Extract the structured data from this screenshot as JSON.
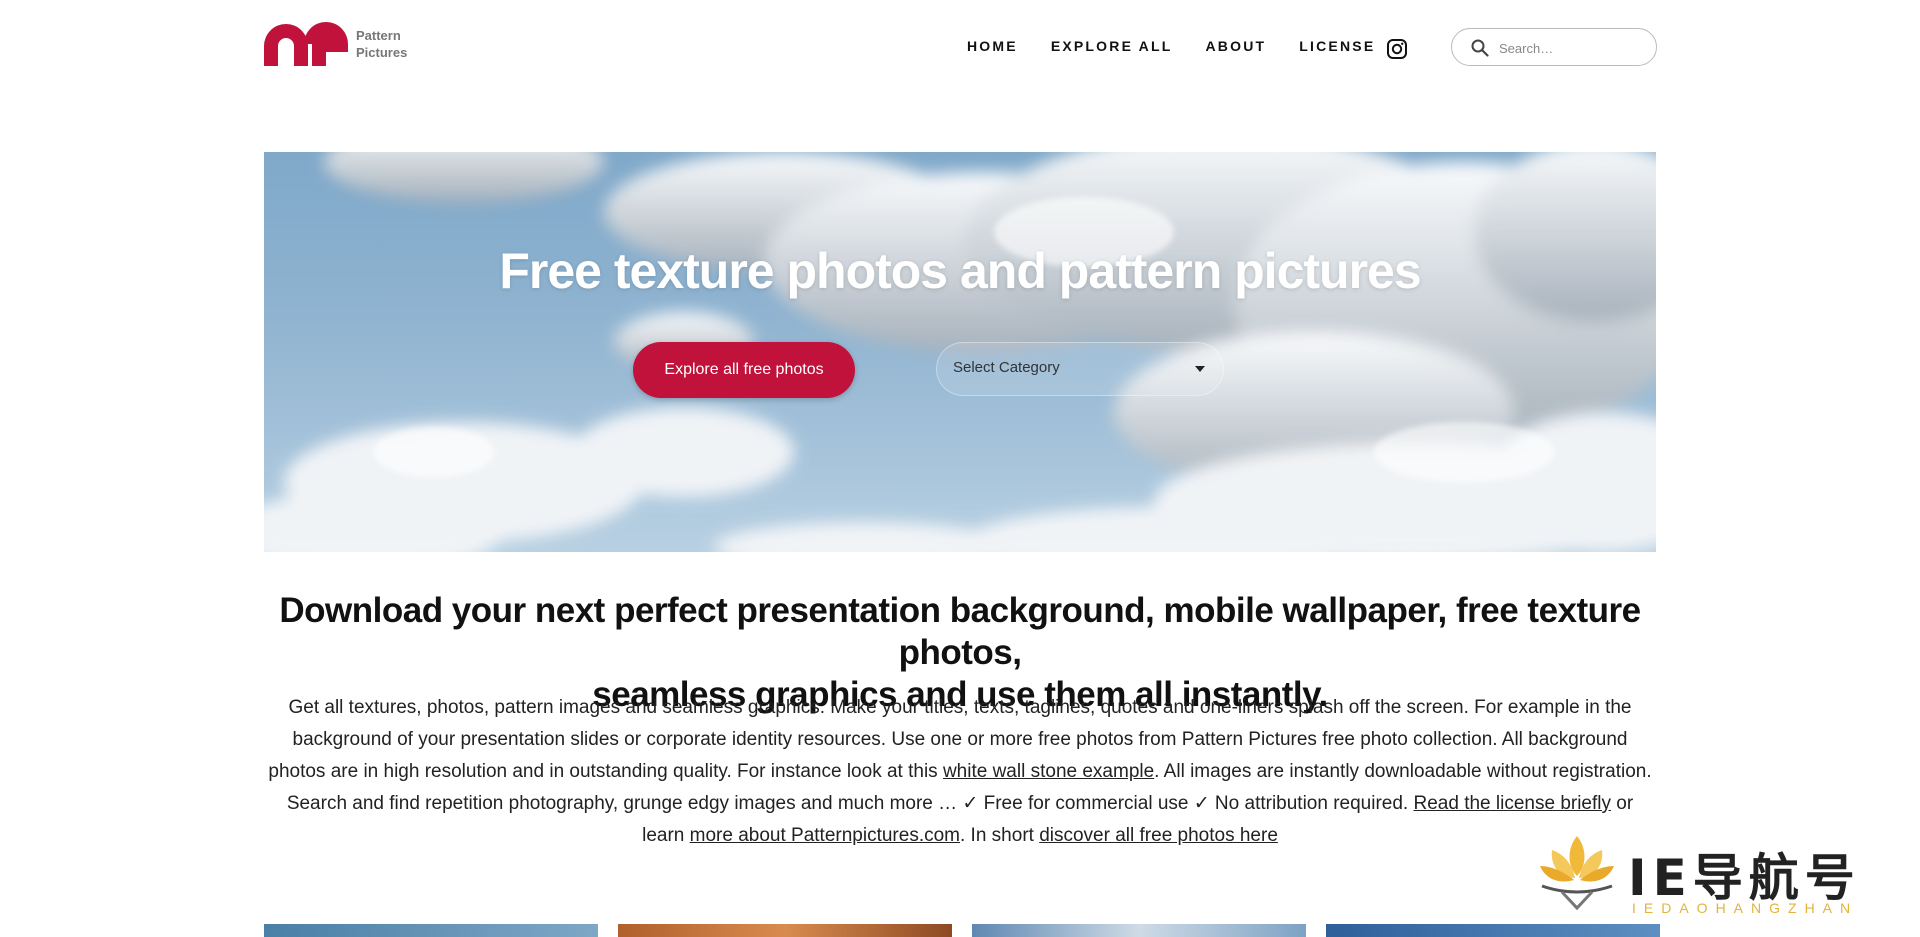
{
  "brand": {
    "name_line1": "Pattern",
    "name_line2": "Pictures",
    "color": "#c0123a"
  },
  "nav": {
    "items": [
      "HOME",
      "EXPLORE ALL",
      "ABOUT",
      "LICENSE"
    ]
  },
  "search": {
    "placeholder": "Search…"
  },
  "hero": {
    "title": "Free texture photos and pattern pictures",
    "button_label": "Explore all free photos",
    "select_label": "Select Category"
  },
  "headline": {
    "line1": "Download your next perfect presentation background, mobile wallpaper, free texture photos,",
    "line2": "seamless graphics and use them all instantly."
  },
  "description": {
    "p1": "Get all textures, photos, pattern images and seamless graphics. Make your titles, texts, taglines, quotes and one-liners splash off the screen. For example in the background of your presentation slides or corporate identity resources. Use one or more free photos from Pattern Pictures free photo collection. All background photos are in high resolution and in outstanding quality. For instance look at this ",
    "link1": "white wall stone example",
    "p2": ". All images are instantly downloadable without registration. Search and find repetition photography, grunge edgy images and much more … ✓ Free for commercial use ✓ No attribution required. ",
    "link2": "Read the license briefly",
    "p3": " or learn ",
    "link3": "more about Patternpictures.com",
    "p4": ". In short ",
    "link4": "discover all free photos here"
  },
  "watermark": {
    "cn": "IE导航号",
    "en": "IEDAOHANGZHAN"
  },
  "icons": {
    "social": "instagram-icon",
    "search": "search-icon",
    "select": "caret-down-icon"
  }
}
